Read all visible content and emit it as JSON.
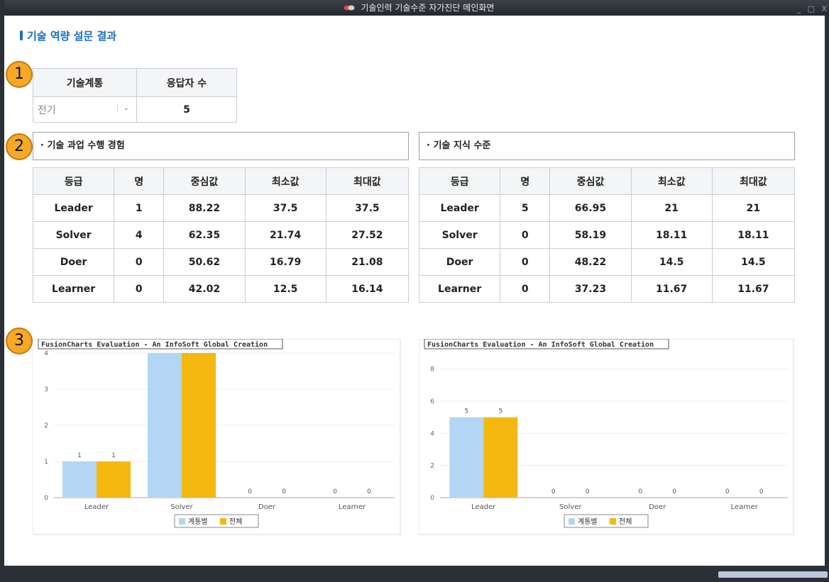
{
  "window": {
    "title": "기술인력 기술수준 자가진단 메인화면",
    "controls": "_ □ X"
  },
  "page_title": "기술 역량 설문 결과",
  "markers": [
    "1",
    "2",
    "3"
  ],
  "summary": {
    "headers": [
      "기술계통",
      "응답자 수"
    ],
    "category_value": "전기",
    "respondents": "5"
  },
  "sections": {
    "left": "· 기술 과업 수행 경험",
    "right": "· 기술 지식 수준"
  },
  "table_headers": [
    "등급",
    "명",
    "중심값",
    "최소값",
    "최대값"
  ],
  "left_table": [
    [
      "Leader",
      "1",
      "88.22",
      "37.5",
      "37.5"
    ],
    [
      "Solver",
      "4",
      "62.35",
      "21.74",
      "27.52"
    ],
    [
      "Doer",
      "0",
      "50.62",
      "16.79",
      "21.08"
    ],
    [
      "Learner",
      "0",
      "42.02",
      "12.5",
      "16.14"
    ]
  ],
  "right_table": [
    [
      "Leader",
      "5",
      "66.95",
      "21",
      "21"
    ],
    [
      "Solver",
      "0",
      "58.19",
      "18.11",
      "18.11"
    ],
    [
      "Doer",
      "0",
      "48.22",
      "14.5",
      "14.5"
    ],
    [
      "Learner",
      "0",
      "37.23",
      "11.67",
      "11.67"
    ]
  ],
  "colors": {
    "series1": "#b3d6f4",
    "series2": "#f4b810",
    "accent": "#1a6fbf",
    "marker": "#f7a825"
  },
  "chart_data": [
    {
      "type": "bar",
      "title": "FusionCharts Evaluation - An InfoSoft Global Creation",
      "categories": [
        "Leader",
        "Solver",
        "Doer",
        "Learner"
      ],
      "series": [
        {
          "name": "계통별",
          "values": [
            1,
            4,
            0,
            0
          ]
        },
        {
          "name": "전체",
          "values": [
            1,
            4,
            0,
            0
          ]
        }
      ],
      "ylim": [
        0,
        4
      ],
      "yticks": [
        0,
        1,
        2,
        3,
        4
      ],
      "grid": true,
      "legend": "bottom"
    },
    {
      "type": "bar",
      "title": "FusionCharts Evaluation - An InfoSoft Global Creation",
      "categories": [
        "Leader",
        "Solver",
        "Doer",
        "Learner"
      ],
      "series": [
        {
          "name": "계통별",
          "values": [
            5,
            0,
            0,
            0
          ]
        },
        {
          "name": "전체",
          "values": [
            5,
            0,
            0,
            0
          ]
        }
      ],
      "ylim": [
        0,
        9
      ],
      "yticks": [
        0,
        2,
        4,
        6,
        8
      ],
      "grid": true,
      "legend": "bottom"
    }
  ]
}
